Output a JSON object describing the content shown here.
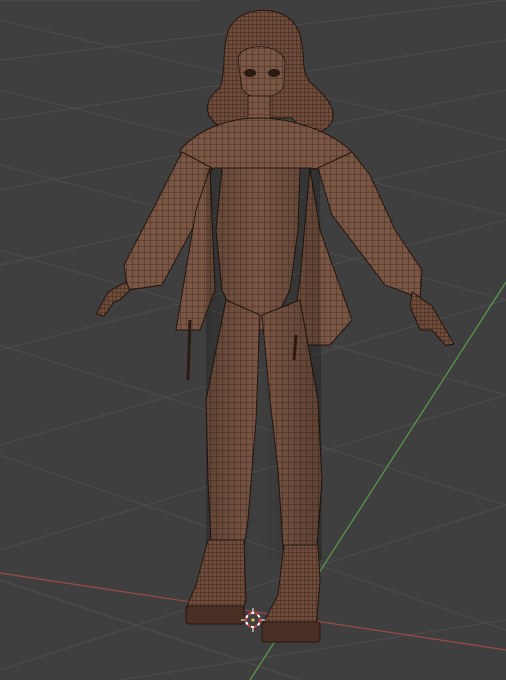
{
  "viewport": {
    "background_color": "#3f3f3f",
    "grid_color": "#4d4d4d",
    "x_axis_color": "#9a4a4a",
    "y_axis_color": "#5c9a4a",
    "mesh_fill_color": "#7a5644",
    "mesh_shadow_color": "#4a3024",
    "wire_color": "#2a1a12",
    "cursor_colors": [
      "#e23b3b",
      "#ffffff"
    ]
  },
  "object": {
    "type": "character-mesh",
    "display_mode": "wireframe-overlay"
  },
  "cursor_icon": "3d-cursor-icon"
}
